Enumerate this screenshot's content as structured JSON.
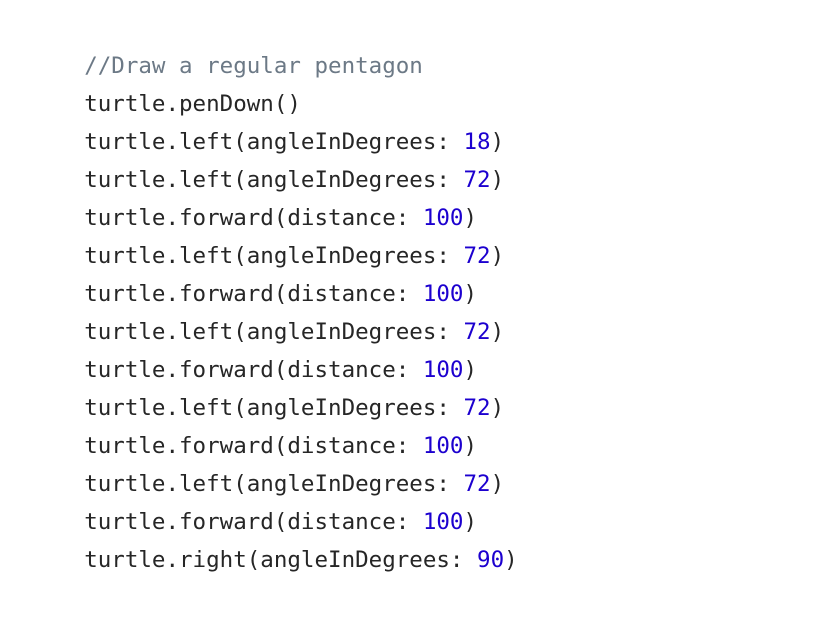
{
  "editor": {
    "colors": {
      "comment": "#6c7986",
      "plain": "#262626",
      "number": "#1c00cf"
    },
    "lines": [
      {
        "type": "comment",
        "text": "//Draw a regular pentagon"
      },
      {
        "type": "code",
        "prefix": "turtle.penDown()",
        "number": "",
        "suffix": ""
      },
      {
        "type": "code",
        "prefix": "turtle.left(angleInDegrees: ",
        "number": "18",
        "suffix": ")"
      },
      {
        "type": "code",
        "prefix": "turtle.left(angleInDegrees: ",
        "number": "72",
        "suffix": ")"
      },
      {
        "type": "code",
        "prefix": "turtle.forward(distance: ",
        "number": "100",
        "suffix": ")"
      },
      {
        "type": "code",
        "prefix": "turtle.left(angleInDegrees: ",
        "number": "72",
        "suffix": ")"
      },
      {
        "type": "code",
        "prefix": "turtle.forward(distance: ",
        "number": "100",
        "suffix": ")"
      },
      {
        "type": "code",
        "prefix": "turtle.left(angleInDegrees: ",
        "number": "72",
        "suffix": ")"
      },
      {
        "type": "code",
        "prefix": "turtle.forward(distance: ",
        "number": "100",
        "suffix": ")"
      },
      {
        "type": "code",
        "prefix": "turtle.left(angleInDegrees: ",
        "number": "72",
        "suffix": ")"
      },
      {
        "type": "code",
        "prefix": "turtle.forward(distance: ",
        "number": "100",
        "suffix": ")"
      },
      {
        "type": "code",
        "prefix": "turtle.left(angleInDegrees: ",
        "number": "72",
        "suffix": ")"
      },
      {
        "type": "code",
        "prefix": "turtle.forward(distance: ",
        "number": "100",
        "suffix": ")"
      },
      {
        "type": "code",
        "prefix": "turtle.right(angleInDegrees: ",
        "number": "90",
        "suffix": ")"
      }
    ]
  }
}
